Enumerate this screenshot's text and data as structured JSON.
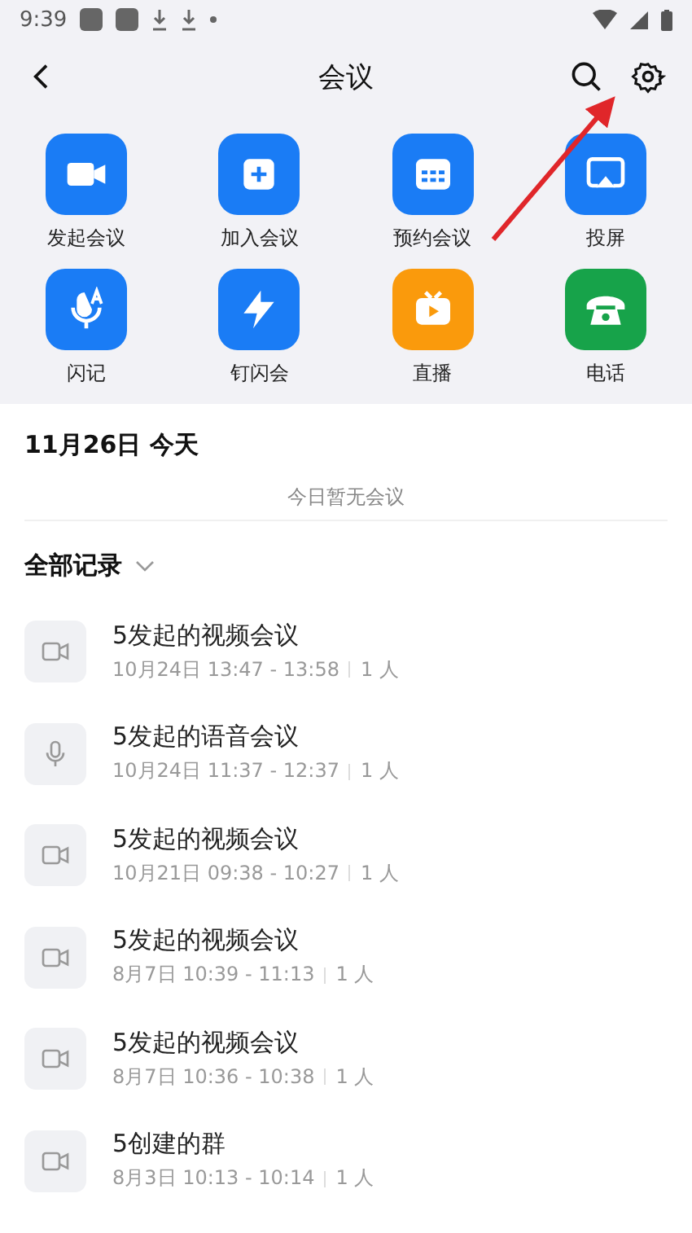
{
  "status_bar": {
    "time": "9:39"
  },
  "header": {
    "title": "会议"
  },
  "actions": [
    {
      "label": "发起会议",
      "color": "#1a7cf5"
    },
    {
      "label": "加入会议",
      "color": "#1a7cf5"
    },
    {
      "label": "预约会议",
      "color": "#1a7cf5"
    },
    {
      "label": "投屏",
      "color": "#1a7cf5"
    },
    {
      "label": "闪记",
      "color": "#1a7cf5"
    },
    {
      "label": "钉闪会",
      "color": "#1a7cf5"
    },
    {
      "label": "直播",
      "color": "#fa9a0c"
    },
    {
      "label": "电话",
      "color": "#17a34a"
    }
  ],
  "today": {
    "date": "11月26日 今天",
    "empty_text": "今日暂无会议"
  },
  "records": {
    "filter": "全部记录",
    "items": [
      {
        "kind": "video",
        "title": "5发起的视频会议",
        "time": "10月24日 13:47 - 13:58",
        "people": "1 人"
      },
      {
        "kind": "voice",
        "title": "5发起的语音会议",
        "time": "10月24日 11:37 - 12:37",
        "people": "1 人"
      },
      {
        "kind": "video",
        "title": "5发起的视频会议",
        "time": "10月21日 09:38 - 10:27",
        "people": "1 人"
      },
      {
        "kind": "video",
        "title": "5发起的视频会议",
        "time": "8月7日 10:39 - 11:13",
        "people": "1 人"
      },
      {
        "kind": "video",
        "title": "5发起的视频会议",
        "time": "8月7日 10:36 - 10:38",
        "people": "1 人"
      },
      {
        "kind": "video",
        "title": "5创建的群",
        "time": "8月3日 10:13 - 10:14",
        "people": "1 人"
      }
    ]
  }
}
